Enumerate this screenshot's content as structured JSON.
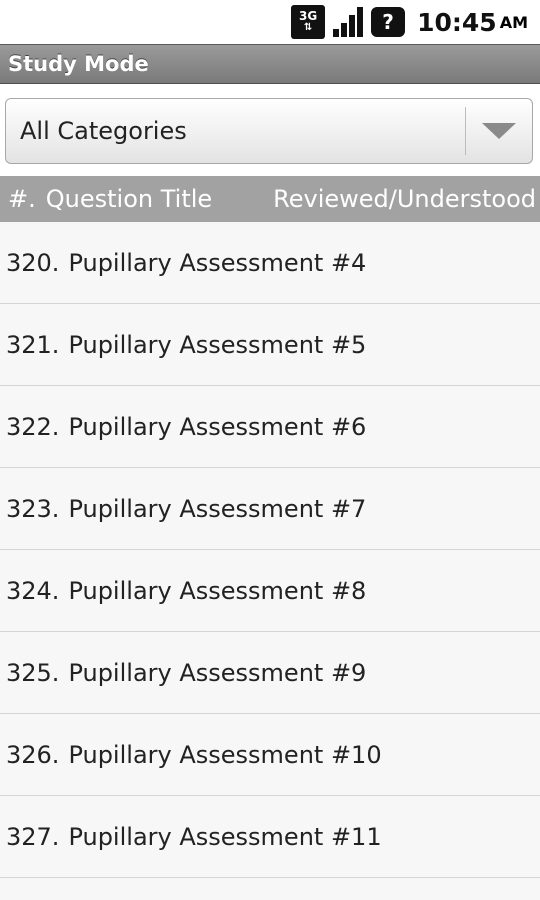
{
  "status_bar": {
    "network": "3G",
    "time": "10:45",
    "ampm": "AM",
    "icons": [
      "3g-icon",
      "signal-icon",
      "question-icon"
    ]
  },
  "title_bar": {
    "title": "Study Mode"
  },
  "category_spinner": {
    "selected": "All Categories"
  },
  "column_header": {
    "number_label": "#.",
    "title_label": "Question Title",
    "status_label": "Reviewed/Understood"
  },
  "questions": [
    {
      "number": "320.",
      "title": "Pupillary Assessment #4"
    },
    {
      "number": "321.",
      "title": "Pupillary Assessment #5"
    },
    {
      "number": "322.",
      "title": "Pupillary Assessment #6"
    },
    {
      "number": "323.",
      "title": "Pupillary Assessment #7"
    },
    {
      "number": "324.",
      "title": "Pupillary Assessment #8"
    },
    {
      "number": "325.",
      "title": "Pupillary Assessment #9"
    },
    {
      "number": "326.",
      "title": "Pupillary Assessment #10"
    },
    {
      "number": "327.",
      "title": "Pupillary Assessment #11"
    }
  ],
  "colors": {
    "title_bar": "#888888",
    "column_header": "#a2a2a2",
    "list_background": "#f7f7f7"
  }
}
